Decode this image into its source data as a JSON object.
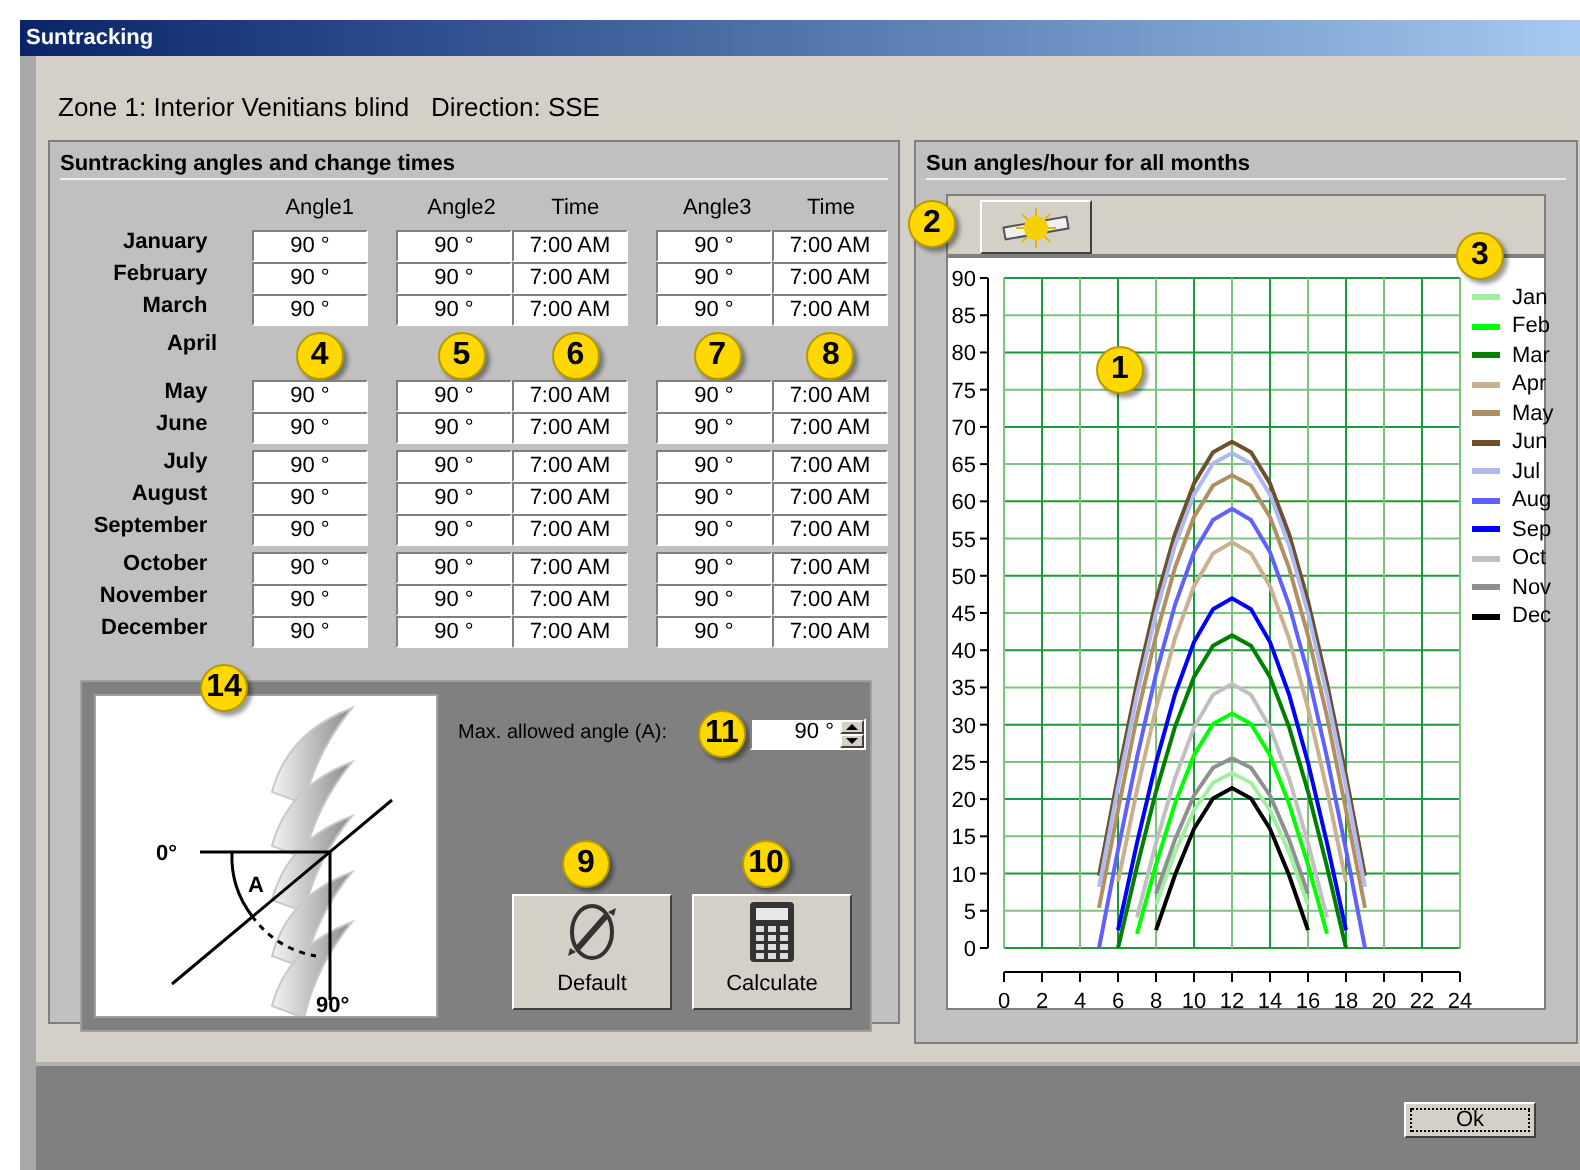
{
  "window": {
    "title": "Suntracking"
  },
  "zone_heading": "Zone 1: Interior Venitians blind   Direction: SSE",
  "angles_group": {
    "title": "Suntracking angles and change times",
    "columns": [
      "Angle1",
      "Angle2",
      "Time",
      "Angle3",
      "Time"
    ],
    "months": [
      {
        "name": "January",
        "cells": [
          "90 °",
          "90 °",
          "7:00 AM",
          "90 °",
          "7:00 AM"
        ]
      },
      {
        "name": "February",
        "cells": [
          "90 °",
          "90 °",
          "7:00 AM",
          "90 °",
          "7:00 AM"
        ]
      },
      {
        "name": "March",
        "cells": [
          "90 °",
          "90 °",
          "7:00 AM",
          "90 °",
          "7:00 AM"
        ]
      },
      {
        "name": "April"
      },
      {
        "name": "May",
        "cells": [
          "90 °",
          "90 °",
          "7:00 AM",
          "90 °",
          "7:00 AM"
        ]
      },
      {
        "name": "June",
        "cells": [
          "90 °",
          "90 °",
          "7:00 AM",
          "90 °",
          "7:00 AM"
        ]
      },
      {
        "name": "July",
        "cells": [
          "90 °",
          "90 °",
          "7:00 AM",
          "90 °",
          "7:00 AM"
        ]
      },
      {
        "name": "August",
        "cells": [
          "90 °",
          "90 °",
          "7:00 AM",
          "90 °",
          "7:00 AM"
        ]
      },
      {
        "name": "September",
        "cells": [
          "90 °",
          "90 °",
          "7:00 AM",
          "90 °",
          "7:00 AM"
        ]
      },
      {
        "name": "October",
        "cells": [
          "90 °",
          "90 °",
          "7:00 AM",
          "90 °",
          "7:00 AM"
        ]
      },
      {
        "name": "November",
        "cells": [
          "90 °",
          "90 °",
          "7:00 AM",
          "90 °",
          "7:00 AM"
        ]
      },
      {
        "name": "December",
        "cells": [
          "90 °",
          "90 °",
          "7:00 AM",
          "90 °",
          "7:00 AM"
        ]
      }
    ]
  },
  "diagram_labels": [
    "0°",
    "A",
    "90°"
  ],
  "max_angle": {
    "label": "Max. allowed angle (A):",
    "value": "90 °"
  },
  "buttons": [
    {
      "label": "Default",
      "kind": "default"
    },
    {
      "label": "Calculate",
      "kind": "calculate"
    }
  ],
  "chart_group": {
    "title": "Sun angles/hour for all months",
    "chart_data": {
      "type": "line",
      "grid": true,
      "legend": true,
      "x": [
        5,
        6,
        7,
        8,
        9,
        10,
        11,
        12,
        13,
        14,
        15,
        16,
        17,
        18,
        19
      ],
      "xlim": [
        0,
        24
      ],
      "ylim": [
        0,
        90
      ],
      "xticks": [
        0,
        2,
        4,
        6,
        8,
        10,
        12,
        14,
        16,
        18,
        20,
        22,
        24
      ],
      "yticks": [
        0,
        5,
        10,
        15,
        20,
        25,
        30,
        35,
        40,
        45,
        50,
        55,
        60,
        65,
        70,
        75,
        80,
        85,
        90
      ],
      "series": [
        {
          "name": "Jan",
          "color": "#a0f0a0",
          "values": [
            null,
            null,
            null,
            5.8,
            12.9,
            18.5,
            22.2,
            23.5,
            22.2,
            18.5,
            12.9,
            5.8,
            null,
            null,
            null
          ]
        },
        {
          "name": "Feb",
          "color": "#00ff00",
          "values": [
            null,
            null,
            1.9,
            11.2,
            19.4,
            25.9,
            30.1,
            31.5,
            30.1,
            25.9,
            19.4,
            11.2,
            1.9,
            null,
            null
          ]
        },
        {
          "name": "Mar",
          "color": "#008000",
          "values": [
            null,
            0,
            10.9,
            21,
            29.7,
            36.4,
            40.6,
            42,
            40.6,
            36.4,
            29.7,
            21,
            10.9,
            0,
            null
          ]
        },
        {
          "name": "Apr",
          "color": "#c8b090",
          "values": [
            null,
            8.9,
            21.2,
            32.2,
            41.6,
            48.6,
            53,
            54.5,
            53,
            48.6,
            41.6,
            32.2,
            21.2,
            8.9,
            null
          ]
        },
        {
          "name": "May",
          "color": "#b09060",
          "values": [
            5.4,
            18.5,
            31.1,
            42,
            51.1,
            57.9,
            62.1,
            63.5,
            62.1,
            57.9,
            51.1,
            42,
            31.1,
            18.5,
            5.4
          ]
        },
        {
          "name": "Jun",
          "color": "#6b5030",
          "values": [
            9.7,
            23.1,
            35.6,
            46.6,
            55.6,
            62.4,
            66.6,
            68,
            66.6,
            62.4,
            55.6,
            46.6,
            35.6,
            23.1,
            9.7
          ]
        },
        {
          "name": "Jul",
          "color": "#b0b8f0",
          "values": [
            8.2,
            21.6,
            34,
            45,
            54.1,
            60.9,
            65.1,
            66.5,
            65.1,
            60.9,
            54.1,
            45,
            34,
            21.6,
            8.2
          ]
        },
        {
          "name": "Aug",
          "color": "#6060ff",
          "values": [
            0,
            13.2,
            25.6,
            36.8,
            46.1,
            53.2,
            57.5,
            59,
            57.5,
            53.2,
            46.1,
            36.8,
            25.6,
            13.2,
            0
          ]
        },
        {
          "name": "Sep",
          "color": "#0000ff",
          "values": [
            null,
            2.4,
            14.1,
            24.9,
            34.1,
            41.1,
            45.5,
            47,
            45.5,
            41.1,
            34.1,
            24.9,
            14.1,
            2.4,
            null
          ]
        },
        {
          "name": "Oct",
          "color": "#c0c0c0",
          "values": [
            null,
            null,
            4.1,
            14.1,
            22.8,
            29.6,
            34,
            35.5,
            34,
            29.6,
            22.8,
            14.1,
            4.1,
            null,
            null
          ]
        },
        {
          "name": "Nov",
          "color": "#909090",
          "values": [
            null,
            null,
            null,
            7.3,
            14.6,
            20.5,
            24.2,
            25.5,
            24.2,
            20.5,
            14.6,
            7.3,
            null,
            null,
            null
          ]
        },
        {
          "name": "Dec",
          "color": "#000000",
          "values": [
            null,
            null,
            null,
            2.4,
            9.8,
            16,
            20.1,
            21.5,
            20.1,
            16,
            9.8,
            2.4,
            null,
            null,
            null
          ]
        }
      ]
    }
  },
  "ok_button": "Ok",
  "callouts": [
    "1",
    "2",
    "3",
    "4",
    "5",
    "6",
    "7",
    "8",
    "9",
    "10",
    "11",
    "14"
  ]
}
